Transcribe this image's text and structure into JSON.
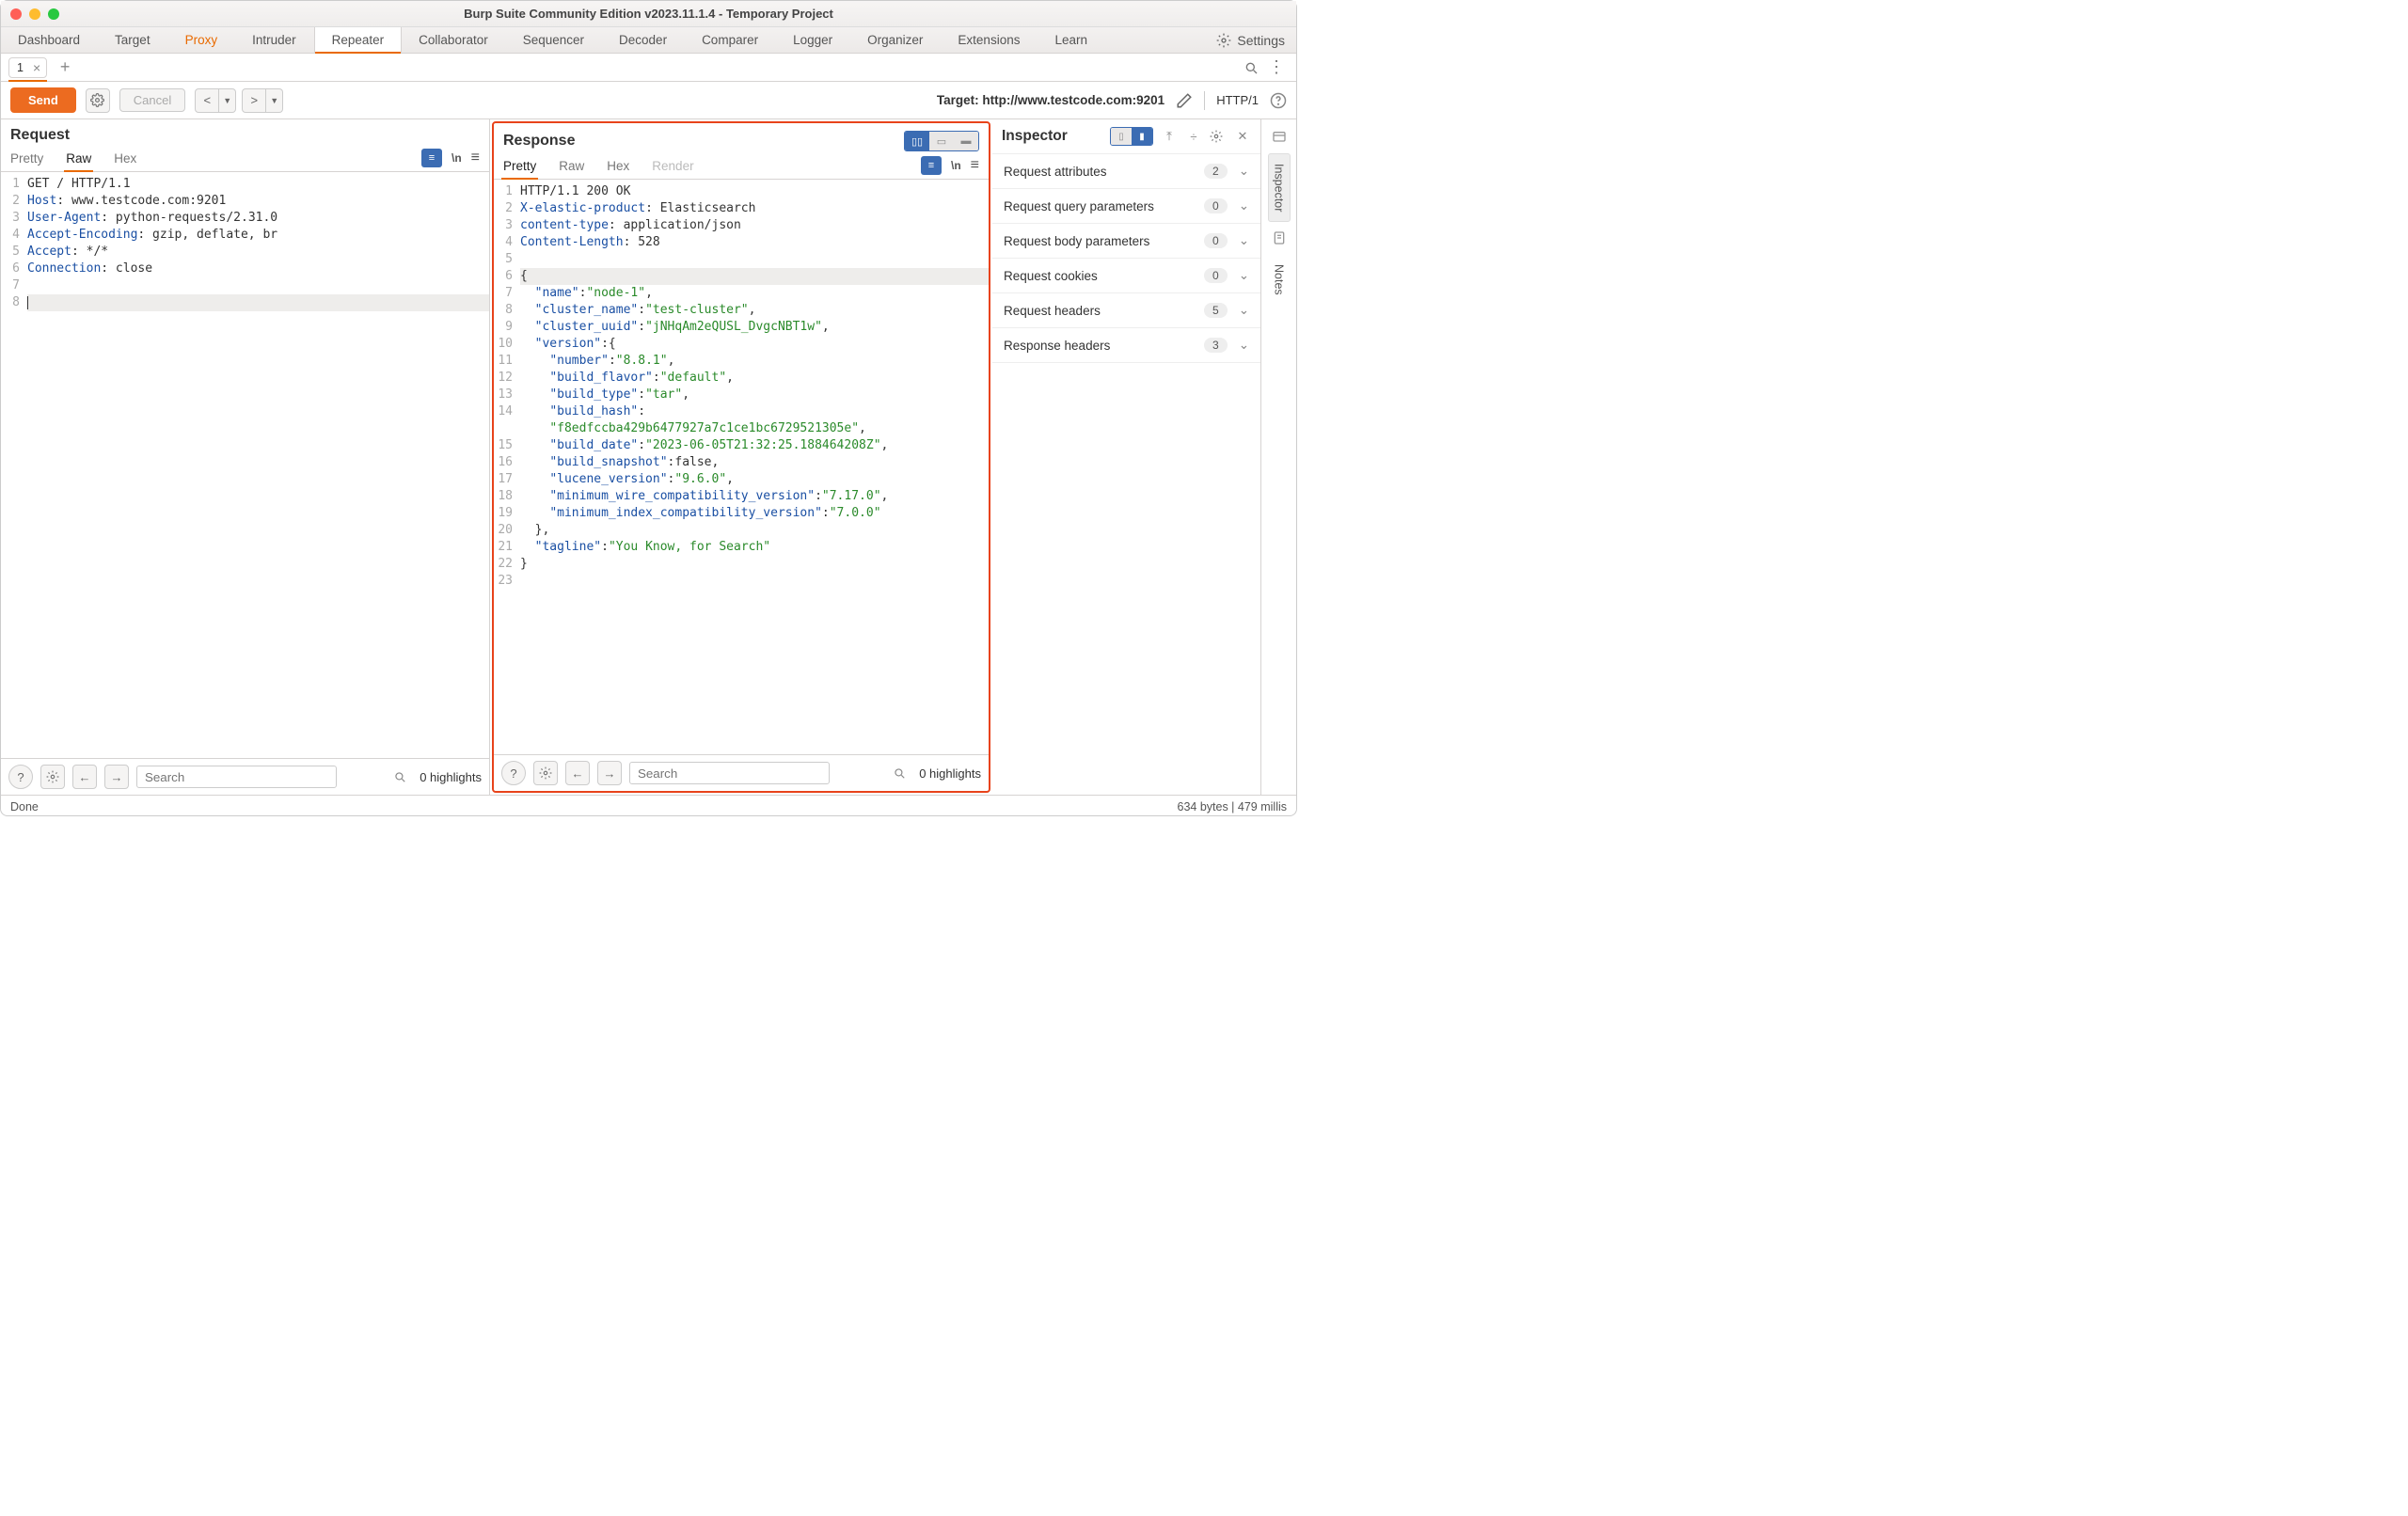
{
  "window": {
    "title": "Burp Suite Community Edition v2023.11.1.4 - Temporary Project"
  },
  "toptabs": [
    "Dashboard",
    "Target",
    "Proxy",
    "Intruder",
    "Repeater",
    "Collaborator",
    "Sequencer",
    "Decoder",
    "Comparer",
    "Logger",
    "Organizer",
    "Extensions",
    "Learn"
  ],
  "toptabs_active_orange": "Proxy",
  "toptabs_active_white": "Repeater",
  "settings_label": "Settings",
  "subtab": {
    "num": "1",
    "close": "×"
  },
  "toolbar": {
    "send": "Send",
    "cancel": "Cancel",
    "target_label": "Target: ",
    "target_value": "http://www.testcode.com:9201",
    "http_label": "HTTP/1"
  },
  "request": {
    "title": "Request",
    "view_tabs": [
      "Pretty",
      "Raw",
      "Hex"
    ],
    "active_tab": "Raw",
    "newline": "\\n",
    "lines": [
      {
        "n": "1",
        "segs": [
          {
            "c": "hv",
            "t": "GET / HTTP/1.1"
          }
        ]
      },
      {
        "n": "2",
        "segs": [
          {
            "c": "hk",
            "t": "Host"
          },
          {
            "c": "hv",
            "t": ": www.testcode.com:9201"
          }
        ]
      },
      {
        "n": "3",
        "segs": [
          {
            "c": "hk",
            "t": "User-Agent"
          },
          {
            "c": "hv",
            "t": ": python-requests/2.31.0"
          }
        ]
      },
      {
        "n": "4",
        "segs": [
          {
            "c": "hk",
            "t": "Accept-Encoding"
          },
          {
            "c": "hv",
            "t": ": gzip, deflate, br"
          }
        ]
      },
      {
        "n": "5",
        "segs": [
          {
            "c": "hk",
            "t": "Accept"
          },
          {
            "c": "hv",
            "t": ": */*"
          }
        ]
      },
      {
        "n": "6",
        "segs": [
          {
            "c": "hk",
            "t": "Connection"
          },
          {
            "c": "hv",
            "t": ": close"
          }
        ]
      },
      {
        "n": "7",
        "segs": [
          {
            "c": "hv",
            "t": " "
          }
        ]
      },
      {
        "n": "8",
        "segs": [
          {
            "c": "hv",
            "t": ""
          }
        ],
        "hl": true,
        "cursor": true
      }
    ],
    "search_placeholder": "Search",
    "highlights": "0 highlights"
  },
  "response": {
    "title": "Response",
    "view_tabs": [
      "Pretty",
      "Raw",
      "Hex",
      "Render"
    ],
    "active_tab": "Pretty",
    "newline": "\\n",
    "lines": [
      {
        "n": "1",
        "segs": [
          {
            "c": "hv",
            "t": "HTTP/1.1 200 OK"
          }
        ]
      },
      {
        "n": "2",
        "segs": [
          {
            "c": "hk",
            "t": "X-elastic-product"
          },
          {
            "c": "hv",
            "t": ": Elasticsearch"
          }
        ]
      },
      {
        "n": "3",
        "segs": [
          {
            "c": "hk",
            "t": "content-type"
          },
          {
            "c": "hv",
            "t": ": application/json"
          }
        ]
      },
      {
        "n": "4",
        "segs": [
          {
            "c": "hk",
            "t": "Content-Length"
          },
          {
            "c": "hv",
            "t": ": 528"
          }
        ]
      },
      {
        "n": "5",
        "segs": [
          {
            "c": "hv",
            "t": " "
          }
        ]
      },
      {
        "n": "6",
        "segs": [
          {
            "c": "hv",
            "t": "{"
          }
        ],
        "hl": true
      },
      {
        "n": "7",
        "segs": [
          {
            "c": "hv",
            "t": "  "
          },
          {
            "c": "hk",
            "t": "\"name\""
          },
          {
            "c": "hv",
            "t": ":"
          },
          {
            "c": "gr",
            "t": "\"node-1\""
          },
          {
            "c": "hv",
            "t": ","
          }
        ]
      },
      {
        "n": "8",
        "segs": [
          {
            "c": "hv",
            "t": "  "
          },
          {
            "c": "hk",
            "t": "\"cluster_name\""
          },
          {
            "c": "hv",
            "t": ":"
          },
          {
            "c": "gr",
            "t": "\"test-cluster\""
          },
          {
            "c": "hv",
            "t": ","
          }
        ]
      },
      {
        "n": "9",
        "segs": [
          {
            "c": "hv",
            "t": "  "
          },
          {
            "c": "hk",
            "t": "\"cluster_uuid\""
          },
          {
            "c": "hv",
            "t": ":"
          },
          {
            "c": "gr",
            "t": "\"jNHqAm2eQUSL_DvgcNBT1w\""
          },
          {
            "c": "hv",
            "t": ","
          }
        ]
      },
      {
        "n": "10",
        "segs": [
          {
            "c": "hv",
            "t": "  "
          },
          {
            "c": "hk",
            "t": "\"version\""
          },
          {
            "c": "hv",
            "t": ":{"
          }
        ]
      },
      {
        "n": "11",
        "segs": [
          {
            "c": "hv",
            "t": "    "
          },
          {
            "c": "hk",
            "t": "\"number\""
          },
          {
            "c": "hv",
            "t": ":"
          },
          {
            "c": "gr",
            "t": "\"8.8.1\""
          },
          {
            "c": "hv",
            "t": ","
          }
        ]
      },
      {
        "n": "12",
        "segs": [
          {
            "c": "hv",
            "t": "    "
          },
          {
            "c": "hk",
            "t": "\"build_flavor\""
          },
          {
            "c": "hv",
            "t": ":"
          },
          {
            "c": "gr",
            "t": "\"default\""
          },
          {
            "c": "hv",
            "t": ","
          }
        ]
      },
      {
        "n": "13",
        "segs": [
          {
            "c": "hv",
            "t": "    "
          },
          {
            "c": "hk",
            "t": "\"build_type\""
          },
          {
            "c": "hv",
            "t": ":"
          },
          {
            "c": "gr",
            "t": "\"tar\""
          },
          {
            "c": "hv",
            "t": ","
          }
        ]
      },
      {
        "n": "14",
        "segs": [
          {
            "c": "hv",
            "t": "    "
          },
          {
            "c": "hk",
            "t": "\"build_hash\""
          },
          {
            "c": "hv",
            "t": ":\n    "
          },
          {
            "c": "gr",
            "t": "\"f8edfccba429b6477927a7c1ce1bc6729521305e\""
          },
          {
            "c": "hv",
            "t": ","
          }
        ]
      },
      {
        "n": "15",
        "segs": [
          {
            "c": "hv",
            "t": "    "
          },
          {
            "c": "hk",
            "t": "\"build_date\""
          },
          {
            "c": "hv",
            "t": ":"
          },
          {
            "c": "gr",
            "t": "\"2023-06-05T21:32:25.188464208Z\""
          },
          {
            "c": "hv",
            "t": ","
          }
        ]
      },
      {
        "n": "16",
        "segs": [
          {
            "c": "hv",
            "t": "    "
          },
          {
            "c": "hk",
            "t": "\"build_snapshot\""
          },
          {
            "c": "hv",
            "t": ":false,"
          }
        ]
      },
      {
        "n": "17",
        "segs": [
          {
            "c": "hv",
            "t": "    "
          },
          {
            "c": "hk",
            "t": "\"lucene_version\""
          },
          {
            "c": "hv",
            "t": ":"
          },
          {
            "c": "gr",
            "t": "\"9.6.0\""
          },
          {
            "c": "hv",
            "t": ","
          }
        ]
      },
      {
        "n": "18",
        "segs": [
          {
            "c": "hv",
            "t": "    "
          },
          {
            "c": "hk",
            "t": "\"minimum_wire_compatibility_version\""
          },
          {
            "c": "hv",
            "t": ":"
          },
          {
            "c": "gr",
            "t": "\"7.17.0\""
          },
          {
            "c": "hv",
            "t": ","
          }
        ]
      },
      {
        "n": "19",
        "segs": [
          {
            "c": "hv",
            "t": "    "
          },
          {
            "c": "hk",
            "t": "\"minimum_index_compatibility_version\""
          },
          {
            "c": "hv",
            "t": ":"
          },
          {
            "c": "gr",
            "t": "\"7.0.0\""
          }
        ]
      },
      {
        "n": "20",
        "segs": [
          {
            "c": "hv",
            "t": "  },"
          }
        ]
      },
      {
        "n": "21",
        "segs": [
          {
            "c": "hv",
            "t": "  "
          },
          {
            "c": "hk",
            "t": "\"tagline\""
          },
          {
            "c": "hv",
            "t": ":"
          },
          {
            "c": "gr",
            "t": "\"You Know, for Search\""
          }
        ]
      },
      {
        "n": "22",
        "segs": [
          {
            "c": "hv",
            "t": "}"
          }
        ]
      },
      {
        "n": "23",
        "segs": [
          {
            "c": "hv",
            "t": " "
          }
        ]
      }
    ],
    "search_placeholder": "Search",
    "highlights": "0 highlights"
  },
  "inspector": {
    "title": "Inspector",
    "rows": [
      {
        "label": "Request attributes",
        "count": "2"
      },
      {
        "label": "Request query parameters",
        "count": "0"
      },
      {
        "label": "Request body parameters",
        "count": "0"
      },
      {
        "label": "Request cookies",
        "count": "0"
      },
      {
        "label": "Request headers",
        "count": "5"
      },
      {
        "label": "Response headers",
        "count": "3"
      }
    ]
  },
  "rail": {
    "inspector": "Inspector",
    "notes": "Notes"
  },
  "status": {
    "left": "Done",
    "right": "634 bytes | 479 millis"
  }
}
